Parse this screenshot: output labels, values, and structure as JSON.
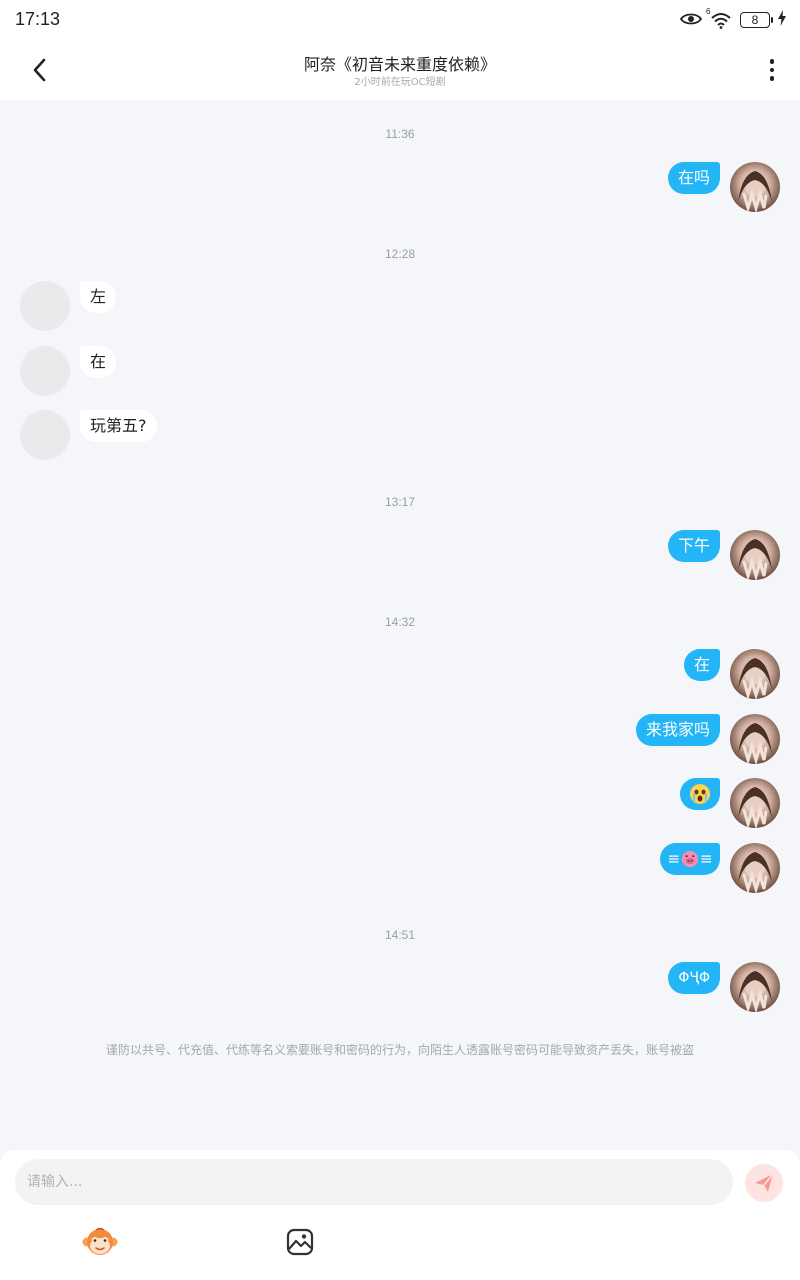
{
  "status_bar": {
    "time": "17:13",
    "battery": "8",
    "network": "6"
  },
  "header": {
    "title": "阿奈《初音未来重度依赖》",
    "subtitle": "2小时前在玩OC短剧"
  },
  "timestamps": [
    "11:36",
    "12:28",
    "13:17",
    "14:32",
    "14:51"
  ],
  "messages": {
    "m1": "在吗",
    "m2": "左",
    "m3": "在",
    "m4": "玩第五?",
    "m5": "下午",
    "m6": "在",
    "m7": "来我家吗",
    "m10": "ΦҶΦ"
  },
  "emoji_messages": {
    "m8": "crying-face-emoji",
    "m9": "pig-face-emoji"
  },
  "notice": "谨防以共号、代充值、代练等名义索要账号和密码的行为，向陌生人透露账号密码可能导致资产丢失，账号被盗",
  "input": {
    "placeholder": "请输入..."
  },
  "colors": {
    "self_bubble": "#23b5f5",
    "background": "#f4f6f9",
    "send_button": "#fde4e2",
    "send_icon": "#f79a92"
  }
}
